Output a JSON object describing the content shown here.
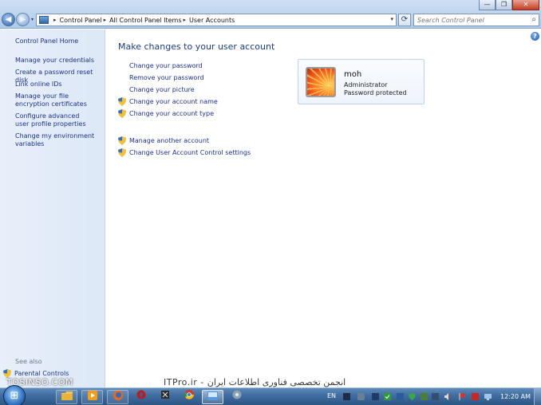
{
  "window": {
    "controls": {
      "minimize": "—",
      "maximize": "❐",
      "close": "✕"
    },
    "nav": {
      "back": "◀",
      "forward": "▶",
      "history_drop": "▾"
    },
    "breadcrumb": [
      "Control Panel",
      "All Control Panel Items",
      "User Accounts"
    ],
    "breadcrumb_separator": "▸",
    "address_drop": "▾",
    "refresh": "⟳",
    "search": {
      "placeholder": "Search Control Panel",
      "icon": "⌕"
    }
  },
  "sidebar": {
    "home": "Control Panel Home",
    "items": [
      {
        "label": "Manage your credentials"
      },
      {
        "label": "Create a password reset disk"
      },
      {
        "label": "Link online IDs"
      },
      {
        "label": "Manage your file encryption certificates"
      },
      {
        "label": "Configure advanced user profile properties"
      },
      {
        "label": "Change my environment variables"
      }
    ],
    "see_also": "See also",
    "parental_controls": "Parental Controls"
  },
  "main": {
    "title": "Make changes to your user account",
    "help": "?",
    "tasks": [
      {
        "label": "Change your password",
        "shield": false
      },
      {
        "label": "Remove your password",
        "shield": false
      },
      {
        "label": "Change your picture",
        "shield": false
      },
      {
        "label": "Change your account name",
        "shield": true
      },
      {
        "label": "Change your account type",
        "shield": true
      }
    ],
    "other_tasks": [
      {
        "label": "Manage another account",
        "shield": true
      },
      {
        "label": "Change User Account Control settings",
        "shield": true
      }
    ],
    "account": {
      "name": "moh",
      "role": "Administrator",
      "status": "Password protected"
    }
  },
  "taskbar": {
    "start": "⊞",
    "language": "EN",
    "clock": "12:20 AM"
  },
  "watermarks": {
    "left": "TOSINSO.COM",
    "right": "ITPro.ir - انجمن تخصصی فناوری اطلاعات ایران"
  },
  "colors": {
    "link": "#1e3287",
    "title": "#1f3c78",
    "sidebar_bg": "#e7effa",
    "taskbar": "#3f6c9f"
  }
}
